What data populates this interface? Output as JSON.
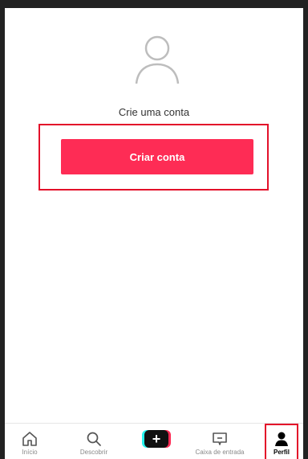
{
  "profile": {
    "prompt": "Crie uma conta",
    "create_account_label": "Criar conta"
  },
  "tabbar": {
    "home_label": "Início",
    "discover_label": "Descobrir",
    "create_symbol": "+",
    "inbox_label": "Caixa de entrada",
    "profile_label": "Perfil",
    "active_tab": "profile"
  },
  "colors": {
    "accent": "#fe2c55",
    "highlight_frame": "#e3102a",
    "create_left": "#25f4ee"
  },
  "icons": {
    "avatar": "person-outline-icon",
    "home": "home-icon",
    "discover": "search-icon",
    "create": "plus-icon",
    "inbox": "message-icon",
    "profile": "person-filled-icon"
  }
}
